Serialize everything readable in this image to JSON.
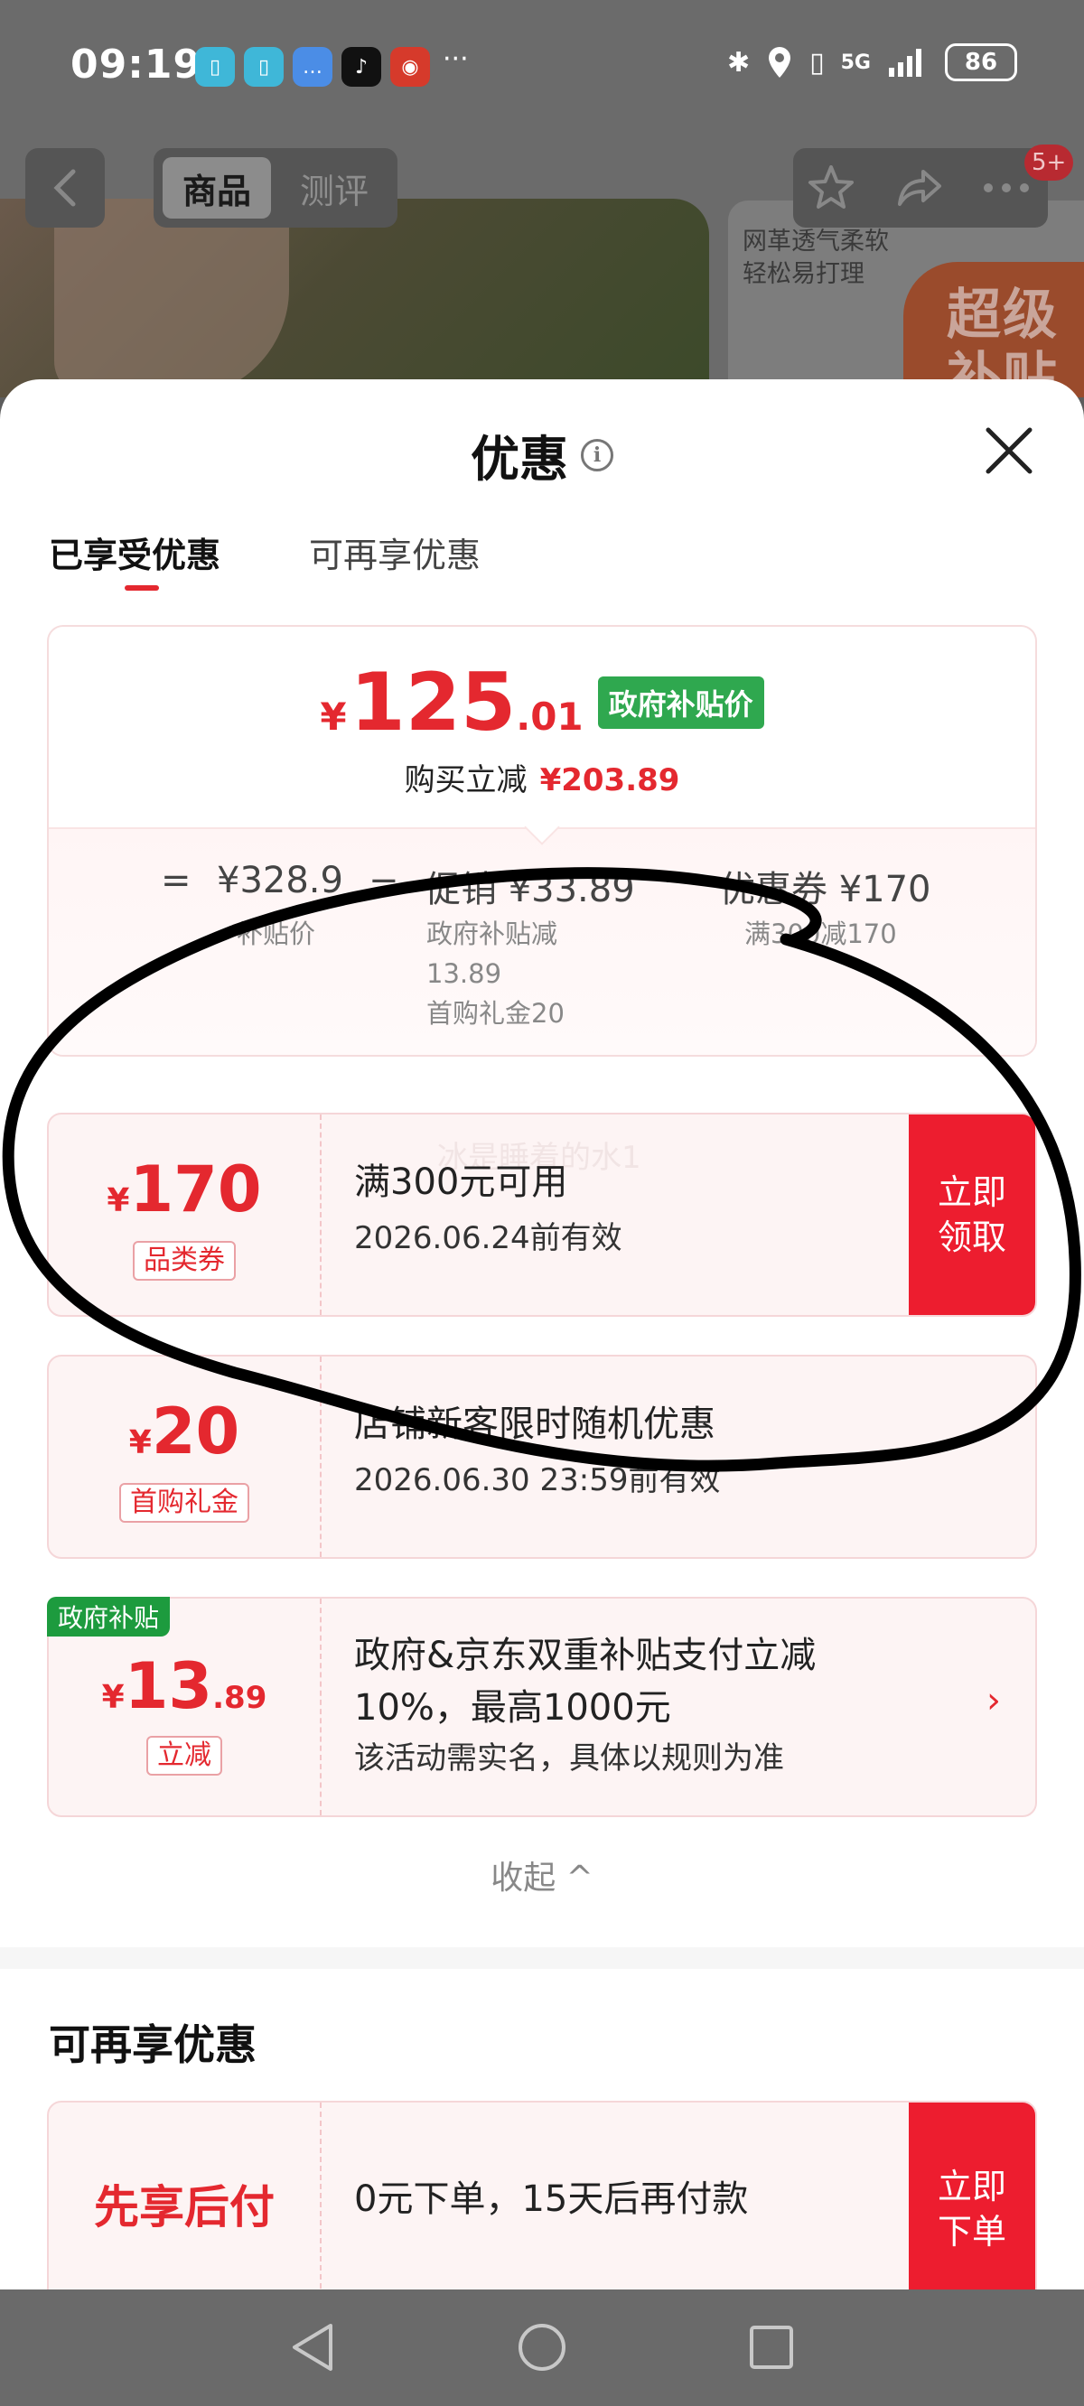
{
  "status_bar": {
    "time": "09:19",
    "more": "···",
    "network": "5G",
    "battery": "86"
  },
  "product_nav": {
    "tabs": [
      "商品",
      "测评"
    ],
    "badge": "5+",
    "side_card_text": "网革透气柔软\n轻松易打理",
    "side_card_badge": "超级\n补贴"
  },
  "sheet": {
    "title": "优惠",
    "tabs": [
      "已享受优惠",
      "可再享优惠"
    ],
    "summary": {
      "price_symbol": "¥",
      "price_int": "125",
      "price_dec": ".01",
      "price_badge": "政府补贴价",
      "buy_label": "购买立减",
      "buy_amount": "¥203.89",
      "eq": "=",
      "subsidy_price": "¥328.9",
      "minus1": "−",
      "promo": "促销 ¥33.89",
      "minus2": "−",
      "coupon": "优惠券 ¥170",
      "subsidy_price_label": "补贴价",
      "promo_detail": "政府补贴减\n13.89\n首购礼金20",
      "coupon_detail": "满300减170"
    },
    "coupons": [
      {
        "symbol": "¥",
        "amount": "170",
        "tag": "品类券",
        "main": "满300元可用",
        "sub": "2026.06.24前有效",
        "button": "立即\n领取",
        "ghost_text": "冰是睡着的水1"
      },
      {
        "symbol": "¥",
        "amount": "20",
        "tag": "首购礼金",
        "main": "店铺新客限时随机优惠",
        "sub": "2026.06.30 23:59前有效"
      },
      {
        "flag": "政府补贴",
        "symbol": "¥",
        "amount": "13",
        "amount_dec": ".89",
        "tag": "立减",
        "main_line1": "政府&京东双重补贴支付立减",
        "main_line2": "10%，最高1000元",
        "sub": "该活动需实名，具体以规则为准",
        "chevron": "›"
      }
    ],
    "collapse": "收起 ^",
    "more_title": "可再享优惠",
    "more_items": [
      {
        "label": "先享后付",
        "main": "0元下单，15天后再付款",
        "button": "立即\n下单"
      }
    ]
  },
  "colors": {
    "accent_red": "#e4282f",
    "button_red": "#ed1d2f",
    "subsidy_green": "#2fa84f",
    "annotation_ink": "#000000"
  }
}
